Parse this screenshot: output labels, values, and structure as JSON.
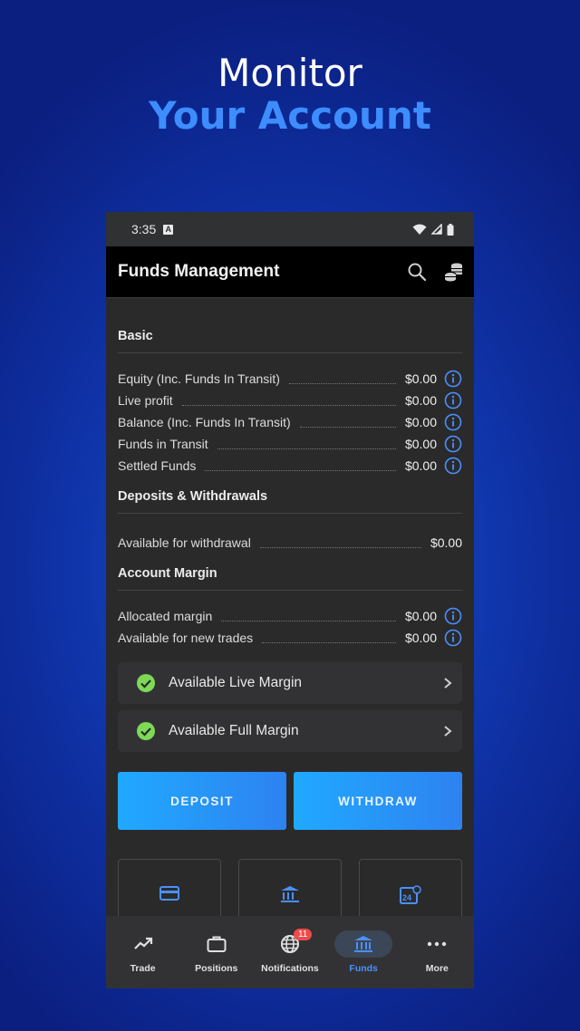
{
  "hero": {
    "line1": "Monitor",
    "line2": "Your Account"
  },
  "statusbar": {
    "time": "3:35",
    "notif_letter": "A"
  },
  "appbar": {
    "title": "Funds Management"
  },
  "basic": {
    "title": "Basic",
    "rows": [
      {
        "label": "Equity (Inc. Funds In Transit)",
        "value": "$0.00"
      },
      {
        "label": "Live profit",
        "value": "$0.00"
      },
      {
        "label": "Balance (Inc. Funds In Transit)",
        "value": "$0.00"
      },
      {
        "label": "Funds in Transit",
        "value": "$0.00"
      },
      {
        "label": "Settled Funds",
        "value": "$0.00"
      }
    ]
  },
  "deposits": {
    "title": "Deposits & Withdrawals",
    "rows": [
      {
        "label": "Available for withdrawal",
        "value": "$0.00"
      }
    ]
  },
  "margin": {
    "title": "Account Margin",
    "rows": [
      {
        "label": "Allocated margin",
        "value": "$0.00"
      },
      {
        "label": "Available for new trades",
        "value": "$0.00"
      }
    ],
    "expanders": [
      "Available Live Margin",
      "Available Full Margin"
    ]
  },
  "actions": {
    "deposit": "DEPOSIT",
    "withdraw": "WITHDRAW"
  },
  "tile_date_text": "24",
  "nav": {
    "items": [
      {
        "label": "Trade"
      },
      {
        "label": "Positions"
      },
      {
        "label": "Notifications",
        "badge": "11"
      },
      {
        "label": "Funds"
      },
      {
        "label": "More"
      }
    ],
    "active": "Funds"
  },
  "colors": {
    "accent": "#4a90ff",
    "hero_accent": "#3d8dff",
    "success": "#7ed957",
    "badge": "#ef4b4b"
  }
}
